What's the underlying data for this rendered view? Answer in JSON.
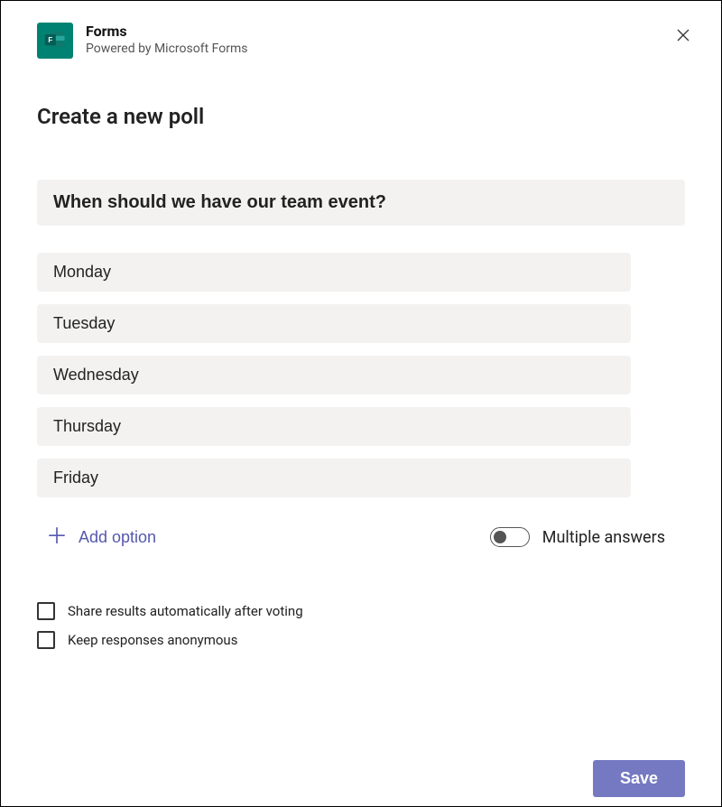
{
  "header": {
    "app_title": "Forms",
    "app_subtitle": "Powered by Microsoft Forms"
  },
  "page": {
    "title": "Create a new poll"
  },
  "poll": {
    "question": "When should we have our team event?",
    "options": [
      "Monday",
      "Tuesday",
      "Wednesday",
      "Thursday",
      "Friday"
    ]
  },
  "controls": {
    "add_option_label": "Add option",
    "multiple_answers_label": "Multiple answers",
    "multiple_answers_on": false
  },
  "settings": {
    "share_results_label": "Share results automatically after voting",
    "share_results_checked": false,
    "anonymous_label": "Keep responses anonymous",
    "anonymous_checked": false
  },
  "footer": {
    "save_label": "Save"
  },
  "colors": {
    "accent": "#7579C2",
    "app_icon_bg": "#008272",
    "field_bg": "#f3f2f1"
  }
}
